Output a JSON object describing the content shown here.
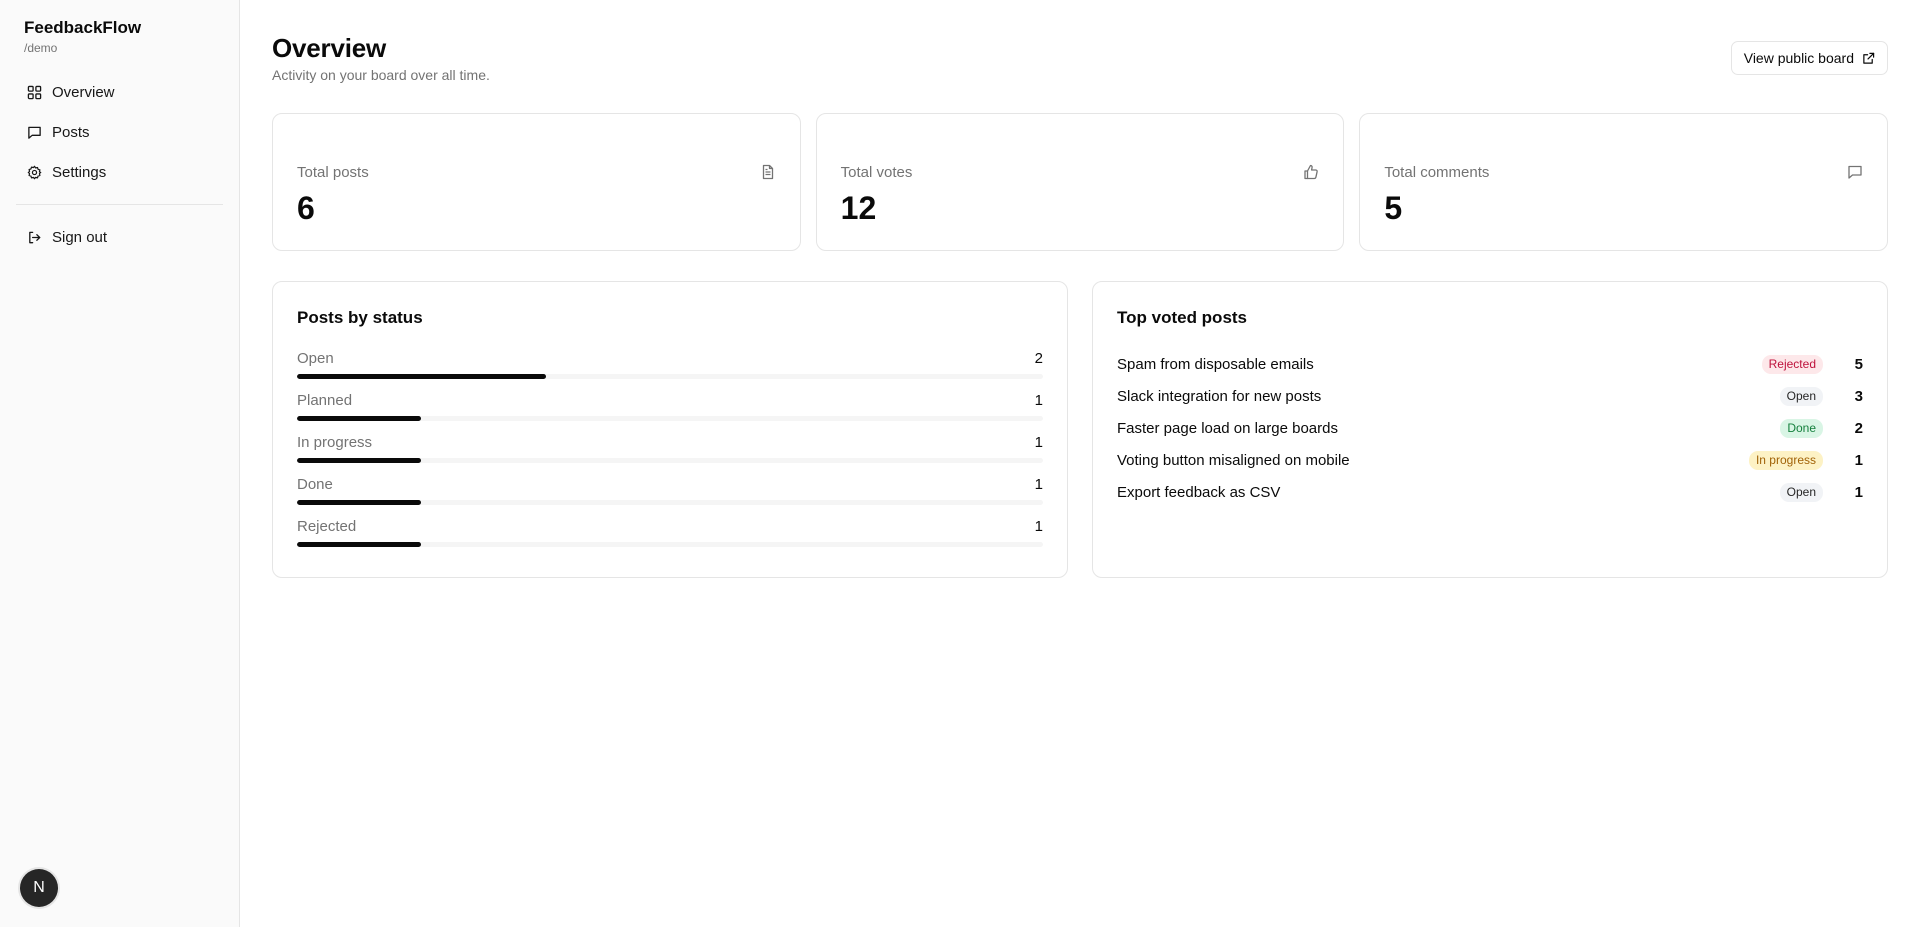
{
  "brand": {
    "name": "FeedbackFlow",
    "slug": "/demo"
  },
  "nav": {
    "items": [
      {
        "label": "Overview",
        "icon": "layout-grid-icon"
      },
      {
        "label": "Posts",
        "icon": "message-square-icon"
      },
      {
        "label": "Settings",
        "icon": "gear-icon"
      }
    ],
    "sign_out": "Sign out"
  },
  "user": {
    "avatar_initial": "N"
  },
  "header": {
    "title": "Overview",
    "subtitle": "Activity on your board over all time.",
    "public_board_label": "View public board"
  },
  "stats": [
    {
      "label": "Total posts",
      "value": "6",
      "icon": "file-text-icon"
    },
    {
      "label": "Total votes",
      "value": "12",
      "icon": "thumbs-up-icon"
    },
    {
      "label": "Total comments",
      "value": "5",
      "icon": "message-square-icon"
    }
  ],
  "posts_by_status": {
    "title": "Posts by status",
    "max": 6,
    "rows": [
      {
        "name": "Open",
        "count": 2
      },
      {
        "name": "Planned",
        "count": 1
      },
      {
        "name": "In progress",
        "count": 1
      },
      {
        "name": "Done",
        "count": 1
      },
      {
        "name": "Rejected",
        "count": 1
      }
    ]
  },
  "top_voted": {
    "title": "Top voted posts",
    "rows": [
      {
        "title": "Spam from disposable emails",
        "status": "Rejected",
        "status_class": "rejected",
        "votes": "5"
      },
      {
        "title": "Slack integration for new posts",
        "status": "Open",
        "status_class": "open",
        "votes": "3"
      },
      {
        "title": "Faster page load on large boards",
        "status": "Done",
        "status_class": "done",
        "votes": "2"
      },
      {
        "title": "Voting button misaligned on mobile",
        "status": "In progress",
        "status_class": "progress",
        "votes": "1"
      },
      {
        "title": "Export feedback as CSV",
        "status": "Open",
        "status_class": "open",
        "votes": "1"
      }
    ]
  },
  "colors": {
    "accent": "#0a0a0a",
    "muted": "#737373",
    "border": "#e5e5e5"
  }
}
